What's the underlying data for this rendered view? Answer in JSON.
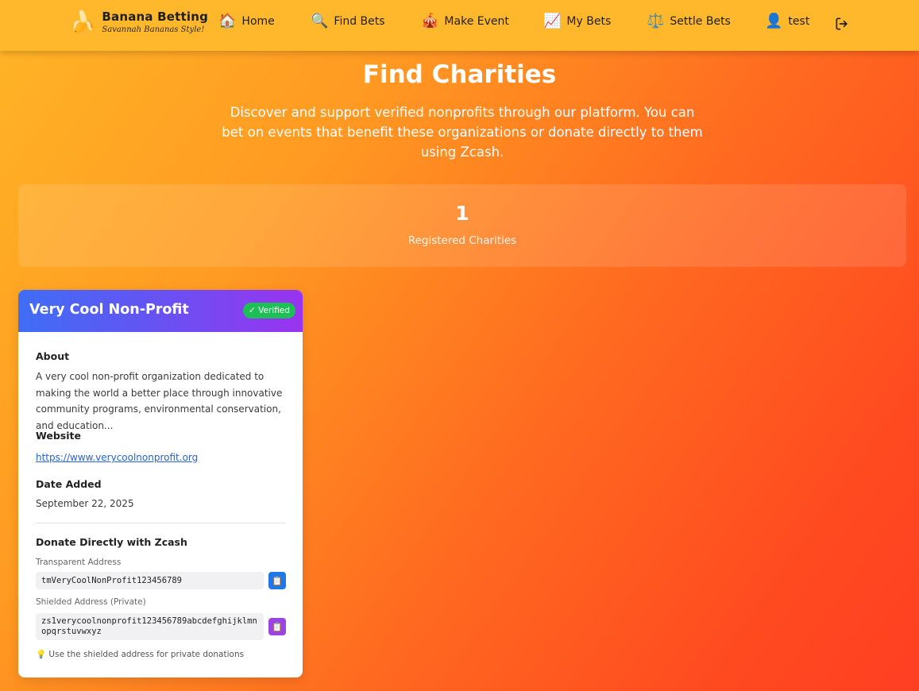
{
  "brand": {
    "logo_icon": "banana-icon",
    "logo_glyph": "🍌",
    "title": "Banana Betting",
    "subtitle": "Savannah Bananas Style!"
  },
  "nav": {
    "home": {
      "icon": "house-icon",
      "glyph": "🏠",
      "label": "Home"
    },
    "find_bets": {
      "icon": "magnifier-icon",
      "glyph": "🔍",
      "label": "Find Bets"
    },
    "make_event": {
      "icon": "circus-tent-icon",
      "glyph": "🎪",
      "label": "Make Event"
    },
    "my_bets": {
      "icon": "chart-up-icon",
      "glyph": "📈",
      "label": "My Bets"
    },
    "settle_bets": {
      "icon": "scales-icon",
      "glyph": "⚖️",
      "label": "Settle Bets"
    },
    "user": {
      "icon": "user-icon",
      "glyph": "👤",
      "label": "test"
    },
    "logout_icon": "logout-icon"
  },
  "hero": {
    "title": "Find Charities",
    "description": "Discover and support verified nonprofits through our platform. You can bet on events that benefit these organizations or donate directly to them using Zcash."
  },
  "stats": {
    "count": "1",
    "label": "Registered Charities"
  },
  "charity": {
    "name": "Very Cool Non-Profit",
    "badge": "✓ Verified",
    "about_label": "About",
    "about_text": "A very cool non-profit organization dedicated to making the world a better place through innovative community programs, environmental conservation, and education...",
    "website_label": "Website",
    "website_url": "https://www.verycoolnonprofit.org",
    "date_label": "Date Added",
    "date_value": "September 22, 2025",
    "donate_label": "Donate Directly with Zcash",
    "transparent_label": "Transparent Address",
    "transparent_address": "tmVeryCoolNonProfit123456789",
    "shielded_label": "Shielded Address (Private)",
    "shielded_address": "zs1verycoolnonprofit123456789abcdefghijklmnopqrstuvwxyz",
    "copy_glyph": "📋",
    "tip_glyph": "💡",
    "tip_text": "Use the shielded address for private donations"
  },
  "colors": {
    "navbar": "#ffb82b",
    "header_gradient_start": "#3f6df6",
    "header_gradient_end": "#9a33f0",
    "verified_badge": "#1fbf57",
    "copy_transparent": "#1f78e8",
    "copy_shielded": "#9a44e6",
    "link": "#2563d6"
  }
}
